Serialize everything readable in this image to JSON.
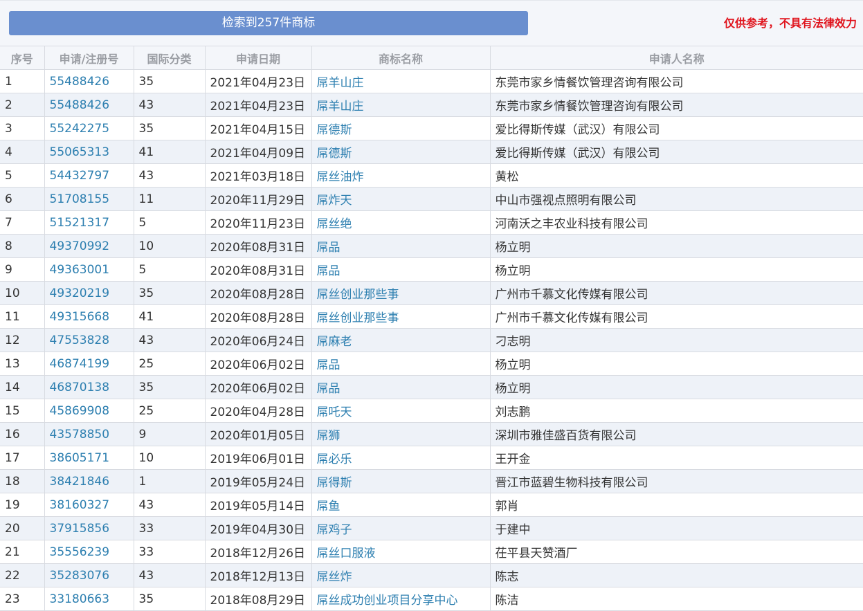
{
  "header": {
    "result_text": "检索到257件商标",
    "disclaimer": "仅供参考，不具有法律效力"
  },
  "colors": {
    "banner": "#6a8fcf",
    "disclaimer": "#e0131c",
    "link": "#2d7fb0",
    "stripe": "#eef2f8"
  },
  "table": {
    "columns": [
      "序号",
      "申请/注册号",
      "国际分类",
      "申请日期",
      "商标名称",
      "申请人名称"
    ],
    "rows": [
      {
        "no": "1",
        "reg": "55488426",
        "cls": "35",
        "date": "2021年04月23日",
        "name": "屌羊山庄",
        "applicant": "东莞市家乡情餐饮管理咨询有限公司"
      },
      {
        "no": "2",
        "reg": "55488426",
        "cls": "43",
        "date": "2021年04月23日",
        "name": "屌羊山庄",
        "applicant": "东莞市家乡情餐饮管理咨询有限公司"
      },
      {
        "no": "3",
        "reg": "55242275",
        "cls": "35",
        "date": "2021年04月15日",
        "name": "屌德斯",
        "applicant": "爱比得斯传媒（武汉）有限公司"
      },
      {
        "no": "4",
        "reg": "55065313",
        "cls": "41",
        "date": "2021年04月09日",
        "name": "屌德斯",
        "applicant": "爱比得斯传媒（武汉）有限公司"
      },
      {
        "no": "5",
        "reg": "54432797",
        "cls": "43",
        "date": "2021年03月18日",
        "name": "屌丝油炸",
        "applicant": "黄松"
      },
      {
        "no": "6",
        "reg": "51708155",
        "cls": "11",
        "date": "2020年11月29日",
        "name": "屌炸天",
        "applicant": "中山市强视点照明有限公司"
      },
      {
        "no": "7",
        "reg": "51521317",
        "cls": "5",
        "date": "2020年11月23日",
        "name": "屌丝绝",
        "applicant": "河南沃之丰农业科技有限公司"
      },
      {
        "no": "8",
        "reg": "49370992",
        "cls": "10",
        "date": "2020年08月31日",
        "name": "屌品",
        "applicant": "杨立明"
      },
      {
        "no": "9",
        "reg": "49363001",
        "cls": "5",
        "date": "2020年08月31日",
        "name": "屌品",
        "applicant": "杨立明"
      },
      {
        "no": "10",
        "reg": "49320219",
        "cls": "35",
        "date": "2020年08月28日",
        "name": "屌丝创业那些事",
        "applicant": "广州市千慕文化传媒有限公司"
      },
      {
        "no": "11",
        "reg": "49315668",
        "cls": "41",
        "date": "2020年08月28日",
        "name": "屌丝创业那些事",
        "applicant": "广州市千慕文化传媒有限公司"
      },
      {
        "no": "12",
        "reg": "47553828",
        "cls": "43",
        "date": "2020年06月24日",
        "name": "屌麻老",
        "applicant": "刁志明"
      },
      {
        "no": "13",
        "reg": "46874199",
        "cls": "25",
        "date": "2020年06月02日",
        "name": "屌品",
        "applicant": "杨立明"
      },
      {
        "no": "14",
        "reg": "46870138",
        "cls": "35",
        "date": "2020年06月02日",
        "name": "屌品",
        "applicant": "杨立明"
      },
      {
        "no": "15",
        "reg": "45869908",
        "cls": "25",
        "date": "2020年04月28日",
        "name": "屌吒天",
        "applicant": "刘志鹏"
      },
      {
        "no": "16",
        "reg": "43578850",
        "cls": "9",
        "date": "2020年01月05日",
        "name": "屌狮",
        "applicant": "深圳市雅佳盛百货有限公司"
      },
      {
        "no": "17",
        "reg": "38605171",
        "cls": "10",
        "date": "2019年06月01日",
        "name": "屌必乐",
        "applicant": "王开金"
      },
      {
        "no": "18",
        "reg": "38421846",
        "cls": "1",
        "date": "2019年05月24日",
        "name": "屌得斯",
        "applicant": "晋江市蓝碧生物科技有限公司"
      },
      {
        "no": "19",
        "reg": "38160327",
        "cls": "43",
        "date": "2019年05月14日",
        "name": "屌鱼",
        "applicant": "郭肖"
      },
      {
        "no": "20",
        "reg": "37915856",
        "cls": "33",
        "date": "2019年04月30日",
        "name": "屌鸡子",
        "applicant": "于建中"
      },
      {
        "no": "21",
        "reg": "35556239",
        "cls": "33",
        "date": "2018年12月26日",
        "name": "屌丝口服液",
        "applicant": "茌平县天赞酒厂"
      },
      {
        "no": "22",
        "reg": "35283076",
        "cls": "43",
        "date": "2018年12月13日",
        "name": "屌丝炸",
        "applicant": "陈志"
      },
      {
        "no": "23",
        "reg": "33180663",
        "cls": "35",
        "date": "2018年08月29日",
        "name": "屌丝成功创业项目分享中心",
        "applicant": "陈洁"
      }
    ]
  }
}
